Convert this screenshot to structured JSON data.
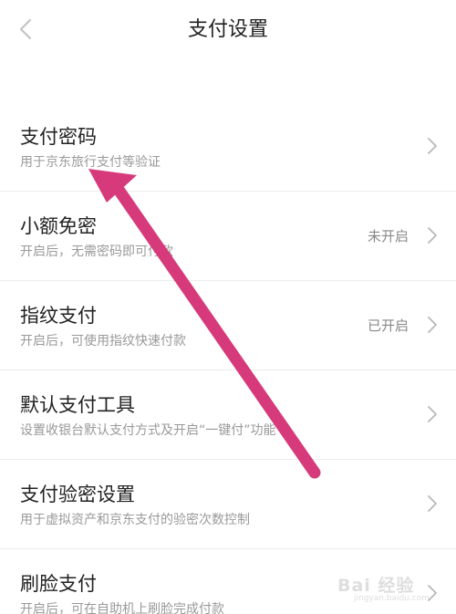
{
  "header": {
    "title": "支付设置",
    "back_icon": "chevron-left-icon"
  },
  "rows": [
    {
      "title": "支付密码",
      "desc": "用于京东旅行支付等验证",
      "status": ""
    },
    {
      "title": "小额免密",
      "desc": "开启后，无需密码即可付款",
      "status": "未开启"
    },
    {
      "title": "指纹支付",
      "desc": "开启后，可使用指纹快速付款",
      "status": "已开启"
    },
    {
      "title": "默认支付工具",
      "desc": "设置收银台默认支付方式及开启“一键付”功能",
      "status": ""
    },
    {
      "title": "支付验密设置",
      "desc": "用于虚拟资产和京东支付的验密次数控制",
      "status": ""
    },
    {
      "title": "刷脸支付",
      "desc": "开启后，可在自助机上刷脸完成付款",
      "status": ""
    }
  ],
  "overlay": {
    "arrow_color": "#d63a7a"
  },
  "watermark": {
    "main": "Bai 经验",
    "sub": "jingyan.baidu.com"
  }
}
